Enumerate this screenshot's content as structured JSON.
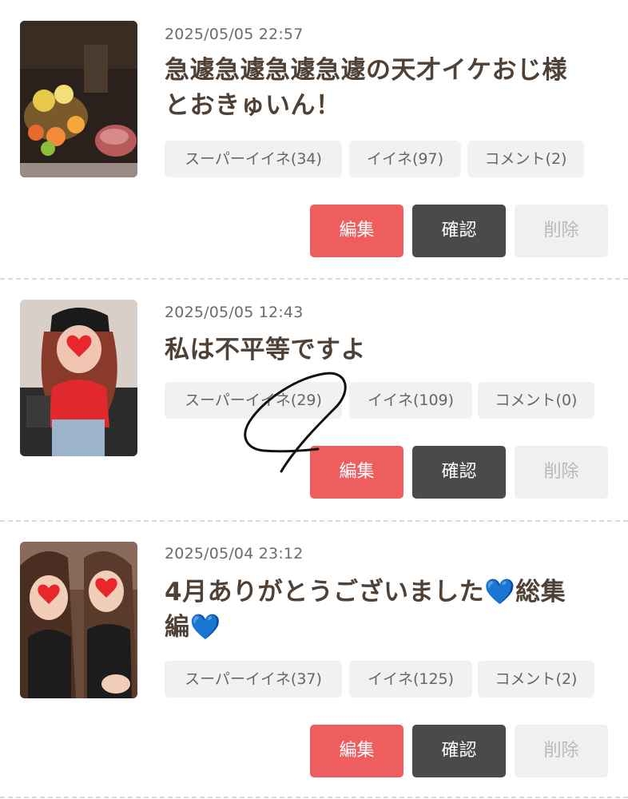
{
  "posts": [
    {
      "date": "2025/05/05 22:57",
      "title_lines": [
        "急遽急遽急遽急遽の天才イケおじ様",
        "とおきゅいん！"
      ],
      "tags": {
        "super_like": "スーパーイイネ(34)",
        "like": "イイネ(97)",
        "comment": "コメント(2)"
      },
      "buttons": {
        "edit": "編集",
        "confirm": "確認",
        "delete": "削除"
      }
    },
    {
      "date": "2025/05/05 12:43",
      "title_lines": [
        "私は不平等ですよ"
      ],
      "tags": {
        "super_like": "スーパーイイネ(29)",
        "like": "イイネ(109)",
        "comment": "コメント(0)"
      },
      "buttons": {
        "edit": "編集",
        "confirm": "確認",
        "delete": "削除"
      }
    },
    {
      "date": "2025/05/04 23:12",
      "title_parts": [
        "4月ありがとうございました",
        "💙",
        "総集",
        "編",
        "💙"
      ],
      "tags": {
        "super_like": "スーパーイイネ(37)",
        "like": "イイネ(125)",
        "comment": "コメント(2)"
      },
      "buttons": {
        "edit": "編集",
        "confirm": "確認",
        "delete": "削除"
      }
    }
  ],
  "colors": {
    "edit": "#ee5e5f",
    "confirm": "#4a4a4a",
    "delete_bg": "#f0f0f0",
    "tag_bg": "#f1f1f1",
    "title": "#4f4136",
    "heart": "#1e7de0"
  }
}
